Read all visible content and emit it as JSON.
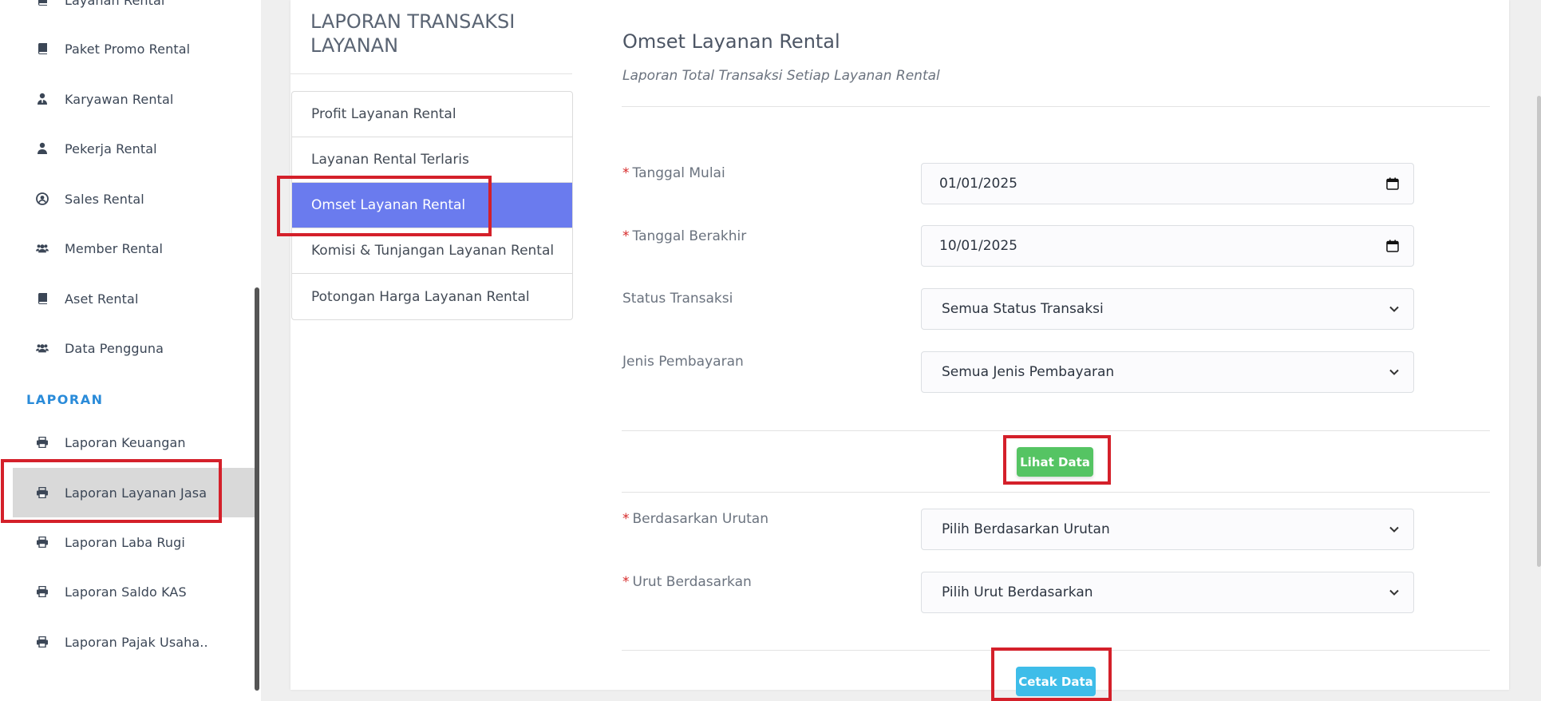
{
  "sidebar": {
    "items": [
      {
        "label": "Layanan Rental",
        "icon": "book-icon"
      },
      {
        "label": "Paket Promo Rental",
        "icon": "book-icon"
      },
      {
        "label": "Karyawan Rental",
        "icon": "user-tie-icon"
      },
      {
        "label": "Pekerja Rental",
        "icon": "user-icon"
      },
      {
        "label": "Sales Rental",
        "icon": "user-circle-icon"
      },
      {
        "label": "Member Rental",
        "icon": "users-icon"
      },
      {
        "label": "Aset Rental",
        "icon": "book-icon"
      },
      {
        "label": "Data Pengguna",
        "icon": "users-icon"
      }
    ],
    "section_label": "LAPORAN",
    "report_items": [
      {
        "label": "Laporan Keuangan",
        "icon": "print-icon"
      },
      {
        "label": "Laporan Layanan Jasa",
        "icon": "print-icon"
      },
      {
        "label": "Laporan Laba Rugi",
        "icon": "print-icon"
      },
      {
        "label": "Laporan Saldo KAS",
        "icon": "print-icon"
      },
      {
        "label": "Laporan Pajak Usaha..",
        "icon": "print-icon"
      }
    ]
  },
  "panel": {
    "title": "LAPORAN TRANSAKSI LAYANAN",
    "menu": [
      "Profit Layanan Rental",
      "Layanan Rental Terlaris",
      "Omset Layanan Rental",
      "Komisi & Tunjangan Layanan Rental",
      "Potongan Harga Layanan Rental"
    ],
    "active_index": 2
  },
  "content": {
    "title": "Omset Layanan Rental",
    "subtitle": "Laporan Total Transaksi Setiap Layanan Rental",
    "required_mark": "*",
    "fields": {
      "start_date_label": "Tanggal Mulai",
      "start_date_value": "01/01/2025",
      "end_date_label": "Tanggal Berakhir",
      "end_date_value": "10/01/2025",
      "status_label": "Status Transaksi",
      "status_value": "Semua Status Transaksi",
      "payment_label": "Jenis Pembayaran",
      "payment_value": "Semua Jenis Pembayaran",
      "order_by_label": "Berdasarkan Urutan",
      "order_by_value": "Pilih Berdasarkan Urutan",
      "sort_label": "Urut Berdasarkan",
      "sort_value": "Pilih Urut Berdasarkan"
    },
    "view_button": "Lihat Data",
    "print_button": "Cetak Data"
  },
  "colors": {
    "accent": "#6a7bee",
    "section": "#2a8bd9",
    "green": "#55c463",
    "cyan": "#3ebde9",
    "highlight": "#d4202a",
    "required": "#d62828"
  }
}
